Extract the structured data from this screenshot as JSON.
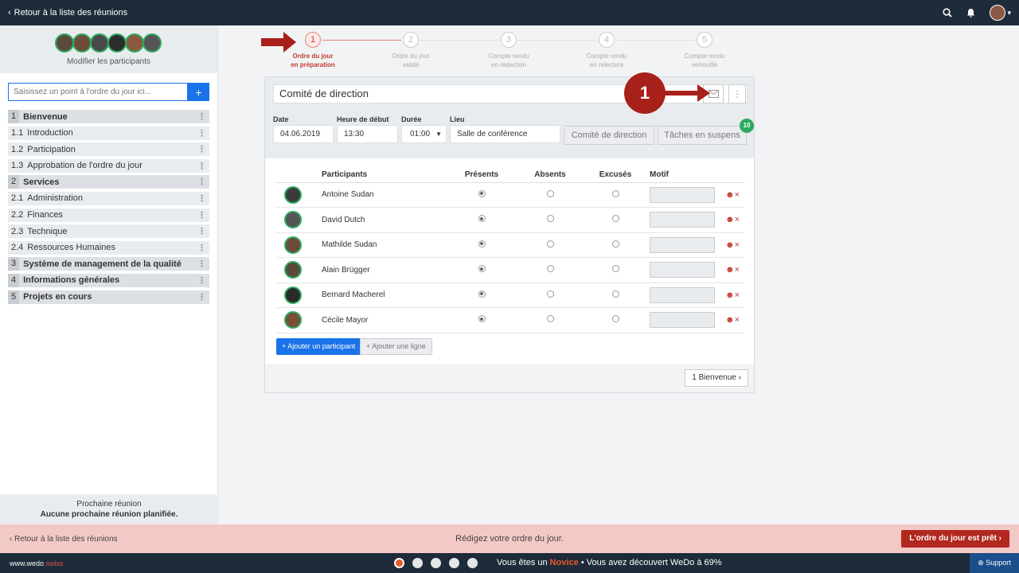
{
  "topbar": {
    "back_label": "Retour à la liste des réunions"
  },
  "sidebar": {
    "edit_participants": "Modifier les participants",
    "search_placeholder": "Saisissez un point à l'ordre du jour ici...",
    "items": [
      {
        "num": "1",
        "label": "Bienvenue",
        "main": true
      },
      {
        "num": "1.1",
        "label": "Introduction",
        "main": false
      },
      {
        "num": "1.2",
        "label": "Participation",
        "main": false
      },
      {
        "num": "1.3",
        "label": "Approbation de l'ordre du jour",
        "main": false
      },
      {
        "num": "2",
        "label": "Services",
        "main": true
      },
      {
        "num": "2.1",
        "label": "Administration",
        "main": false
      },
      {
        "num": "2.2",
        "label": "Finances",
        "main": false
      },
      {
        "num": "2.3",
        "label": "Technique",
        "main": false
      },
      {
        "num": "2.4",
        "label": "Ressources Humaines",
        "main": false
      },
      {
        "num": "3",
        "label": "Système de management de la qualité",
        "main": true
      },
      {
        "num": "4",
        "label": "Informations générales",
        "main": true
      },
      {
        "num": "5",
        "label": "Projets en cours",
        "main": true
      }
    ],
    "next_meeting_title": "Prochaine réunion",
    "next_meeting_value": "Aucune prochaine réunion planifiée."
  },
  "stepper": [
    {
      "num": "1",
      "line1": "Ordre du jour",
      "line2": "en préparation"
    },
    {
      "num": "2",
      "line1": "Ordre du jour",
      "line2": "validé"
    },
    {
      "num": "3",
      "line1": "Compte rendu",
      "line2": "en rédaction"
    },
    {
      "num": "4",
      "line1": "Compte rendu",
      "line2": "en relecture"
    },
    {
      "num": "5",
      "line1": "Compte rendu",
      "line2": "verrouillé"
    }
  ],
  "meeting": {
    "title": "Comité de direction",
    "date_label": "Date",
    "date_value": "04.06.2019",
    "start_label": "Heure de début",
    "start_value": "13:30",
    "duration_label": "Durée",
    "duration_value": "01:00",
    "place_label": "Lieu",
    "place_value": "Salle de conférence",
    "committee_button": "Comité de direction",
    "pending_button": "Tâches en suspens",
    "pending_count": "10"
  },
  "table": {
    "headers": {
      "participants": "Participants",
      "present": "Présents",
      "absent": "Absents",
      "excused": "Excusés",
      "reason": "Motif"
    },
    "rows": [
      {
        "name": "Antoine Sudan",
        "status": "present"
      },
      {
        "name": "David Dutch",
        "status": "present"
      },
      {
        "name": "Mathilde Sudan",
        "status": "present"
      },
      {
        "name": "Alain Brügger",
        "status": "present"
      },
      {
        "name": "Bernard Macherel",
        "status": "present"
      },
      {
        "name": "Cécile Mayor",
        "status": "present"
      }
    ],
    "add_participant": "+ Ajouter un participant",
    "add_line": "+ Ajouter une ligne",
    "next_button": "1 Bienvenue"
  },
  "callout": {
    "number": "1"
  },
  "actionbar": {
    "back_label": "Retour à la liste des réunions",
    "message": "Rédigez votre ordre du jour.",
    "ready_button": "L'ordre du jour est prêt"
  },
  "statusbar": {
    "brand_main": "www.wedo",
    "brand_suffix": ".swiss",
    "text_prefix": "Vous êtes un",
    "level": "Novice",
    "text_suffix": "• Vous avez découvert WeDo à 69%",
    "support": "Support"
  },
  "colors": {
    "accent": "#1a73e8",
    "brand_dark": "#1d2b3a",
    "danger": "#b1281f",
    "success": "#2eaa5e"
  }
}
